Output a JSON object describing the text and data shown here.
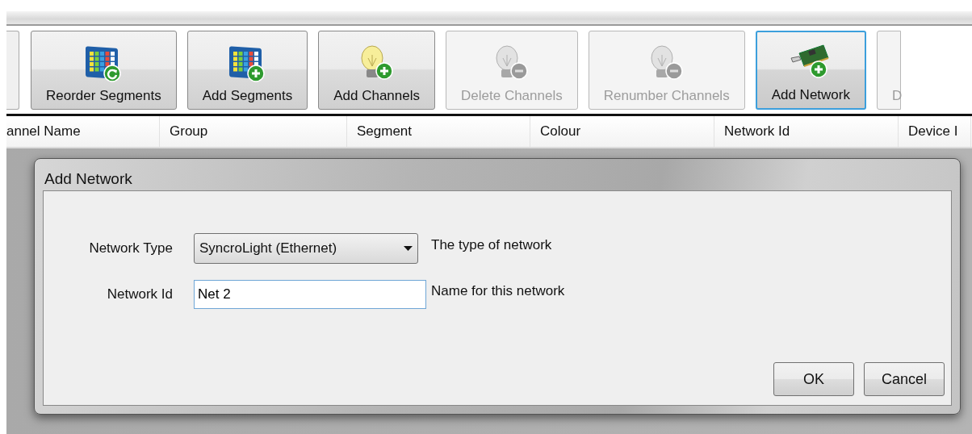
{
  "toolbar": {
    "buttons": [
      {
        "label": "Reorder Segments",
        "kind": "grid-refresh",
        "disabled": false,
        "focused": false
      },
      {
        "label": "Add Segments",
        "kind": "grid-add",
        "disabled": false,
        "focused": false
      },
      {
        "label": "Add Channels",
        "kind": "bulb-add",
        "disabled": false,
        "focused": false
      },
      {
        "label": "Delete Channels",
        "kind": "bulb-remove",
        "disabled": true,
        "focused": false
      },
      {
        "label": "Renumber Channels",
        "kind": "bulb-remove",
        "disabled": true,
        "focused": false
      },
      {
        "label": "Add Network",
        "kind": "card-add",
        "disabled": false,
        "focused": true
      },
      {
        "label": "D",
        "kind": "cut-off",
        "disabled": true,
        "focused": false
      }
    ]
  },
  "table": {
    "columns": [
      "annel Name",
      "Group",
      "Segment",
      "Colour",
      "Network Id",
      "Device I"
    ]
  },
  "dialog": {
    "title": "Add Network",
    "fields": [
      {
        "kind": "dropdown",
        "label": "Network Type",
        "value": "SyncroLight (Ethernet)",
        "hint": "The type of network"
      },
      {
        "kind": "text",
        "label": "Network Id",
        "value": "Net 2",
        "hint": "Name for this network"
      }
    ],
    "buttons": [
      "OK",
      "Cancel"
    ]
  }
}
